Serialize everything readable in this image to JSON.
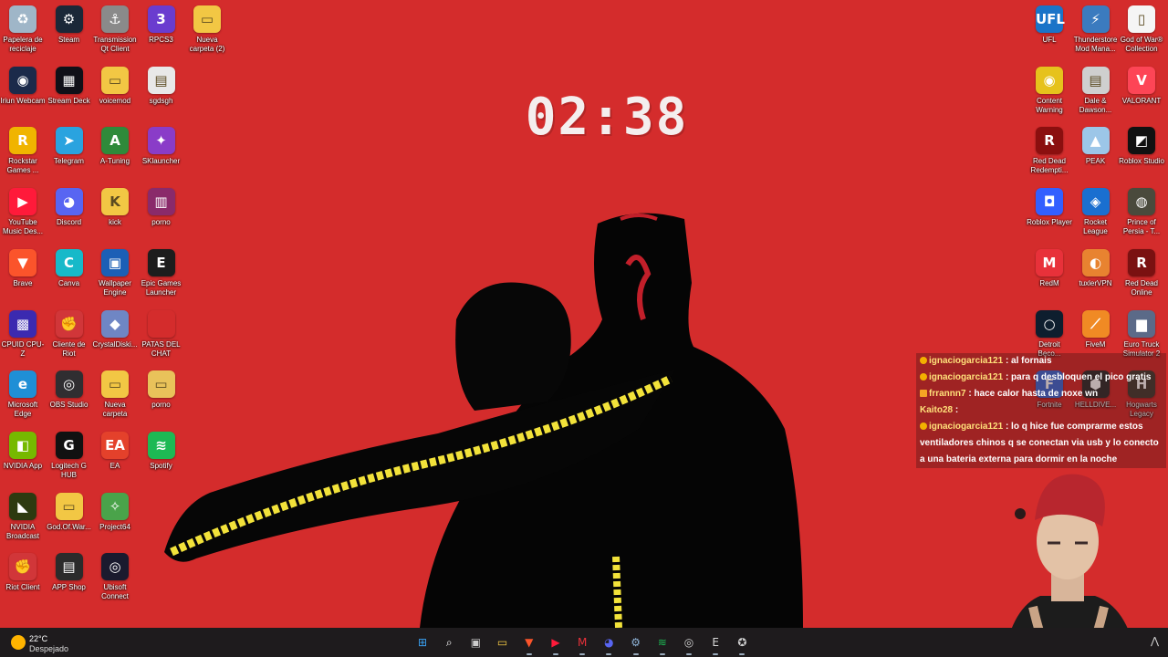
{
  "clock": {
    "time": "02:38"
  },
  "desktop_left": [
    {
      "label": "Papelera de reciclaje",
      "icon": "recycle-bin-icon",
      "glyph": "♻",
      "color": "#9fb6c8"
    },
    {
      "label": "Steam",
      "icon": "steam-icon",
      "glyph": "⚙",
      "color": "#1b2838"
    },
    {
      "label": "Transmission Qt Client",
      "icon": "transmission-icon",
      "glyph": "⚓",
      "color": "#8a8a8a"
    },
    {
      "label": "RPCS3",
      "icon": "rpcs3-icon",
      "glyph": "3",
      "color": "#6a3ccf"
    },
    {
      "label": "Nueva carpeta (2)",
      "icon": "folder-icon",
      "glyph": "▭",
      "color": "#f2c744"
    },
    {
      "label": "Iriun Webcam",
      "icon": "webcam-icon",
      "glyph": "◉",
      "color": "#1b2a4a"
    },
    {
      "label": "Stream Deck",
      "icon": "stream-deck-icon",
      "glyph": "▦",
      "color": "#101018"
    },
    {
      "label": "voicemod",
      "icon": "folder-icon",
      "glyph": "▭",
      "color": "#f2c744"
    },
    {
      "label": "sgdsgh",
      "icon": "image-file-icon",
      "glyph": "▤",
      "color": "#e8e8e8"
    },
    {
      "label": "Rockstar Games ...",
      "icon": "rockstar-icon",
      "glyph": "R",
      "color": "#f0b400"
    },
    {
      "label": "Telegram",
      "icon": "telegram-icon",
      "glyph": "➤",
      "color": "#2aa3df"
    },
    {
      "label": "A-Tuning",
      "icon": "a-tuning-icon",
      "glyph": "A",
      "color": "#2f8a3a"
    },
    {
      "label": "SKlauncher",
      "icon": "sklauncher-icon",
      "glyph": "✦",
      "color": "#8a3cc8"
    },
    {
      "label": "YouTube Music Des...",
      "icon": "youtube-music-icon",
      "glyph": "▶",
      "color": "#ff1a3a"
    },
    {
      "label": "Discord",
      "icon": "discord-icon",
      "glyph": "◕",
      "color": "#5865f2"
    },
    {
      "label": "kick",
      "icon": "folder-icon",
      "glyph": "K",
      "color": "#f2c744"
    },
    {
      "label": "porno",
      "icon": "winrar-icon",
      "glyph": "▥",
      "color": "#8a2a6a"
    },
    {
      "label": "Brave",
      "icon": "brave-icon",
      "glyph": "▼",
      "color": "#fb542b"
    },
    {
      "label": "Canva",
      "icon": "canva-icon",
      "glyph": "C",
      "color": "#17b9c9"
    },
    {
      "label": "Wallpaper Engine",
      "icon": "wallpaper-engine-icon",
      "glyph": "▣",
      "color": "#1c5fb6"
    },
    {
      "label": "Epic Games Launcher",
      "icon": "epic-games-icon",
      "glyph": "E",
      "color": "#1d1d1d"
    },
    {
      "label": "CPUID CPU-Z",
      "icon": "cpu-z-icon",
      "glyph": "▩",
      "color": "#3b2ab0"
    },
    {
      "label": "Cliente de Riot",
      "icon": "riot-client-icon",
      "glyph": "✊",
      "color": "#d13639"
    },
    {
      "label": "CrystalDiski...",
      "icon": "crystaldisk-icon",
      "glyph": "◆",
      "color": "#6f86c4"
    },
    {
      "label": "PATAS DEL CHAT",
      "icon": "blank-icon",
      "glyph": "",
      "color": "transparent"
    },
    {
      "label": "Microsoft Edge",
      "icon": "edge-icon",
      "glyph": "e",
      "color": "#1f8fd6"
    },
    {
      "label": "OBS Studio",
      "icon": "obs-icon",
      "glyph": "◎",
      "color": "#302e31"
    },
    {
      "label": "Nueva carpeta",
      "icon": "folder-icon",
      "glyph": "▭",
      "color": "#f2c744"
    },
    {
      "label": "porno",
      "icon": "folder-icon",
      "glyph": "▭",
      "color": "#e9c25a"
    },
    {
      "label": "NVIDIA App",
      "icon": "nvidia-icon",
      "glyph": "◧",
      "color": "#76b900"
    },
    {
      "label": "Logitech G HUB",
      "icon": "logitech-icon",
      "glyph": "G",
      "color": "#111"
    },
    {
      "label": "EA",
      "icon": "ea-icon",
      "glyph": "EA",
      "color": "#e4412b"
    },
    {
      "label": "Spotify",
      "icon": "spotify-icon",
      "glyph": "≋",
      "color": "#1db954"
    },
    {
      "label": "NVIDIA Broadcast",
      "icon": "nvidia-broadcast-icon",
      "glyph": "◣",
      "color": "#2d3a10"
    },
    {
      "label": "God.Of.War...",
      "icon": "folder-icon",
      "glyph": "▭",
      "color": "#f2c744"
    },
    {
      "label": "Project64",
      "icon": "project64-icon",
      "glyph": "✧",
      "color": "#4aa34a"
    },
    {
      "label": "Riot Client",
      "icon": "riot-client-icon",
      "glyph": "✊",
      "color": "#d13639"
    },
    {
      "label": "APP Shop",
      "icon": "app-shop-icon",
      "glyph": "▤",
      "color": "#2b2b2b"
    },
    {
      "label": "Ubisoft Connect",
      "icon": "ubisoft-icon",
      "glyph": "◎",
      "color": "#1a1a2e"
    }
  ],
  "desktop_right": [
    {
      "label": "UFL",
      "icon": "ufl-icon",
      "glyph": "UFL",
      "color": "#1a74c8"
    },
    {
      "label": "Thunderstore Mod Mana...",
      "icon": "thunderstore-icon",
      "glyph": "⚡",
      "color": "#3b7bbf"
    },
    {
      "label": "God of War® Collection",
      "icon": "blank-file-icon",
      "glyph": "▯",
      "color": "#f5f5f5"
    },
    {
      "label": "Content Warning",
      "icon": "content-warning-icon",
      "glyph": "◉",
      "color": "#e6c21c"
    },
    {
      "label": "Dale & Dawson...",
      "icon": "printer-icon",
      "glyph": "▤",
      "color": "#cfcfcf"
    },
    {
      "label": "VALORANT",
      "icon": "valorant-icon",
      "glyph": "V",
      "color": "#fd4556"
    },
    {
      "label": "Red Dead Redempti...",
      "icon": "rdr-icon",
      "glyph": "R",
      "color": "#8b0f0f"
    },
    {
      "label": "PEAK",
      "icon": "peak-icon",
      "glyph": "▲",
      "color": "#9cc6e8"
    },
    {
      "label": "Roblox Studio",
      "icon": "roblox-studio-icon",
      "glyph": "◩",
      "color": "#111"
    },
    {
      "label": "Roblox Player",
      "icon": "roblox-icon",
      "glyph": "◘",
      "color": "#335fff"
    },
    {
      "label": "Rocket League",
      "icon": "rocket-league-icon",
      "glyph": "◈",
      "color": "#1a6fd0"
    },
    {
      "label": "Prince of Persia - T...",
      "icon": "prince-persia-icon",
      "glyph": "◍",
      "color": "#4a4a3c"
    },
    {
      "label": "RedM",
      "icon": "redm-icon",
      "glyph": "M",
      "color": "#e8313a"
    },
    {
      "label": "tuxlerVPN",
      "icon": "tuxler-icon",
      "glyph": "◐",
      "color": "#e88330"
    },
    {
      "label": "Red Dead Online",
      "icon": "rdo-icon",
      "glyph": "R",
      "color": "#7a1111"
    },
    {
      "label": "Detroit Beco...",
      "icon": "detroit-icon",
      "glyph": "○",
      "color": "#0e1e2e"
    },
    {
      "label": "FiveM",
      "icon": "fivem-icon",
      "glyph": "⟋",
      "color": "#f08a24"
    },
    {
      "label": "Euro Truck Simulator 2",
      "icon": "ets2-icon",
      "glyph": "▆",
      "color": "#5b6a88"
    },
    {
      "label": "Fortnite",
      "icon": "fortnite-icon",
      "glyph": "F",
      "color": "#3c6bd6"
    },
    {
      "label": "HELLDIVE...",
      "icon": "helldivers-icon",
      "glyph": "⬢",
      "color": "#2f2f2f"
    },
    {
      "label": "Hogwarts Legacy",
      "icon": "hogwarts-icon",
      "glyph": "H",
      "color": "#433c33"
    }
  ],
  "chat": [
    {
      "user": "ignaciogarcia121",
      "msg": ": al fornais",
      "badge": "sub"
    },
    {
      "user": "ignaciogarcia121",
      "msg": ": para q desbloquen el pico gratis",
      "badge": "sub"
    },
    {
      "user": "frrannn7",
      "msg": ": hace calor hasta de noxe wn",
      "badge": "crown"
    },
    {
      "user": "Kaito28",
      "msg": ":",
      "badge": "none"
    },
    {
      "user": "ignaciogarcia121",
      "msg": ": lo q hice fue comprarme estos ventiladores chinos q se conectan via usb y lo conecto a una bateria externa para dormir en la noche",
      "badge": "sub"
    }
  ],
  "weather": {
    "temp": "22°C",
    "condition": "Despejado"
  },
  "taskbar": [
    {
      "name": "start-icon",
      "glyph": "⊞",
      "color": "#3aa0f0"
    },
    {
      "name": "search-icon",
      "glyph": "⌕",
      "color": "#ffffff"
    },
    {
      "name": "task-view-icon",
      "glyph": "▣",
      "color": "#cccccc"
    },
    {
      "name": "file-explorer-icon",
      "glyph": "▭",
      "color": "#f2c744"
    },
    {
      "name": "brave-icon",
      "glyph": "▼",
      "color": "#fb542b"
    },
    {
      "name": "youtube-music-icon",
      "glyph": "▶",
      "color": "#ff1a3a"
    },
    {
      "name": "redm-icon",
      "glyph": "M",
      "color": "#e8313a"
    },
    {
      "name": "discord-icon",
      "glyph": "◕",
      "color": "#5865f2"
    },
    {
      "name": "steam-icon",
      "glyph": "⚙",
      "color": "#8fb4d8"
    },
    {
      "name": "spotify-icon",
      "glyph": "≋",
      "color": "#1db954"
    },
    {
      "name": "obs-icon",
      "glyph": "◎",
      "color": "#cfcfcf"
    },
    {
      "name": "epic-games-icon",
      "glyph": "E",
      "color": "#d8d8d8"
    },
    {
      "name": "gpu-tool-icon",
      "glyph": "✪",
      "color": "#d0d0d0"
    }
  ]
}
